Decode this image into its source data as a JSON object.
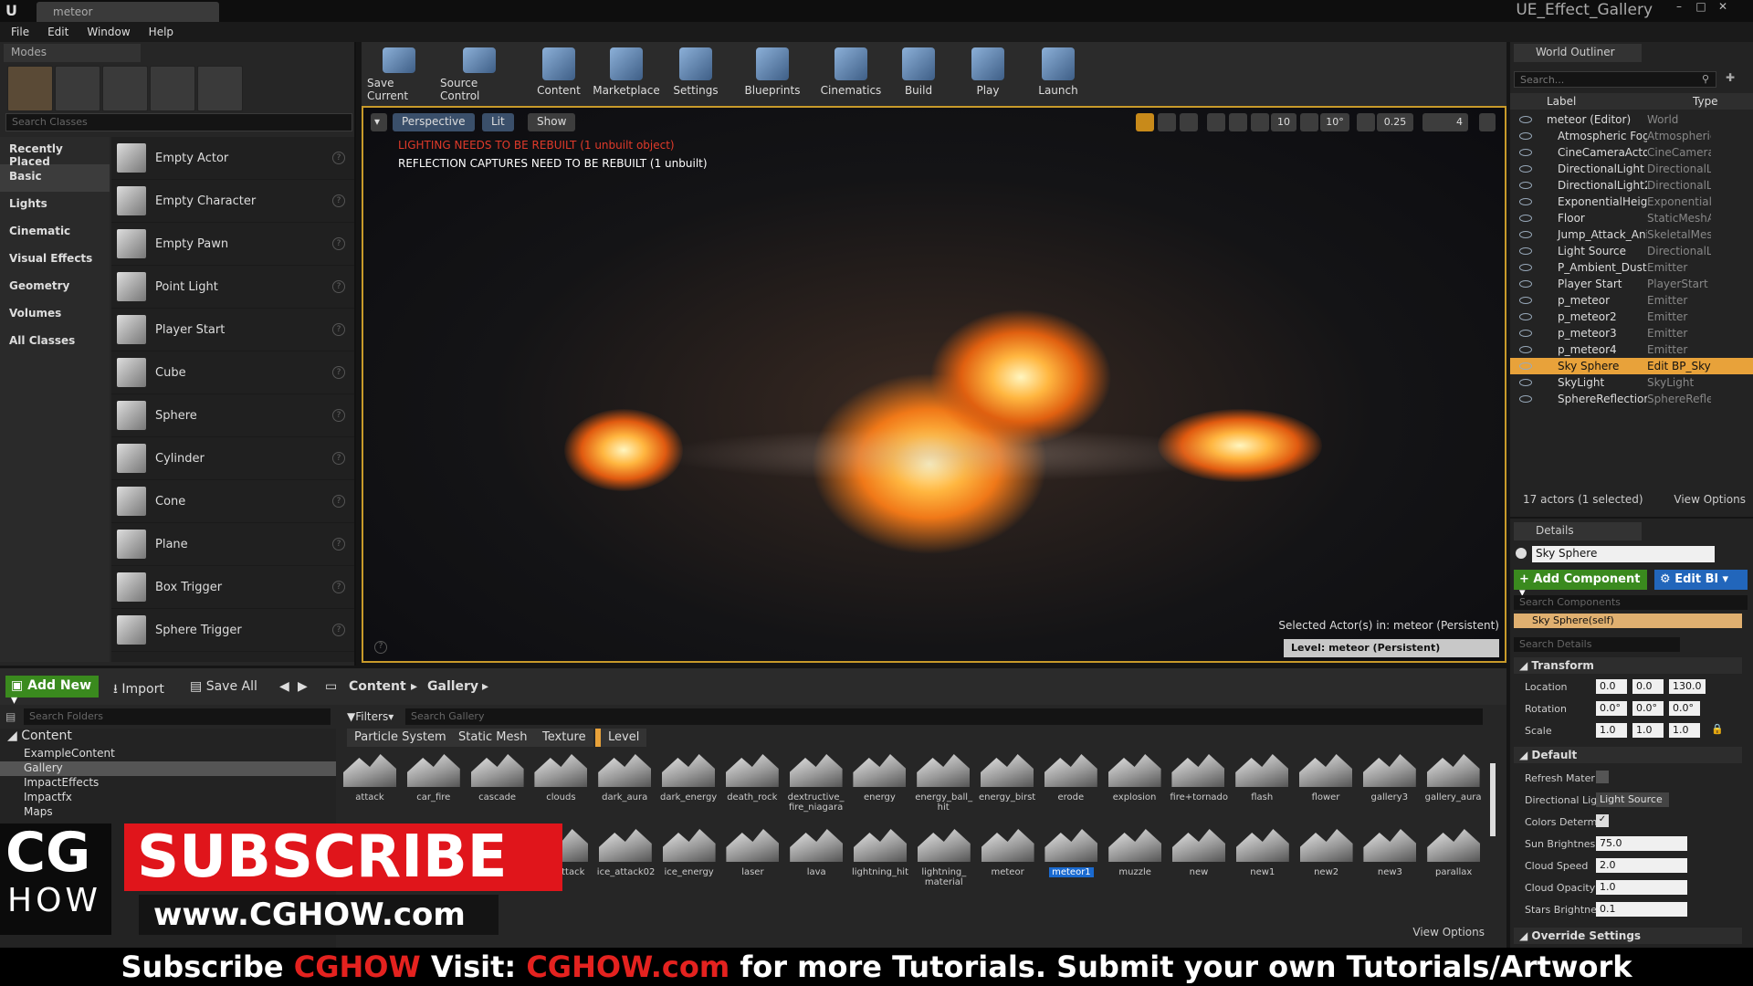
{
  "titlebar": {
    "doc_tab": "meteor",
    "app_title": "UE_Effect_Gallery"
  },
  "menu": [
    "File",
    "Edit",
    "Window",
    "Help"
  ],
  "modes": {
    "tab": "Modes",
    "search_placeholder": "Search Classes",
    "categories": [
      "Recently Placed",
      "Basic",
      "Lights",
      "Cinematic",
      "Visual Effects",
      "Geometry",
      "Volumes",
      "All Classes"
    ],
    "selected_category": "Basic",
    "classes": [
      "Empty Actor",
      "Empty Character",
      "Empty Pawn",
      "Point Light",
      "Player Start",
      "Cube",
      "Sphere",
      "Cylinder",
      "Cone",
      "Plane",
      "Box Trigger",
      "Sphere Trigger"
    ]
  },
  "toolbar": [
    "Save Current",
    "Source Control",
    "Content",
    "Marketplace",
    "Settings",
    "Blueprints",
    "Cinematics",
    "Build",
    "Play",
    "Launch"
  ],
  "viewport": {
    "perspective": "Perspective",
    "lit": "Lit",
    "show": "Show",
    "warning_lighting": "LIGHTING NEEDS TO BE REBUILT (1 unbuilt object)",
    "warning_reflection": "REFLECTION CAPTURES NEED TO BE REBUILT (1 unbuilt)",
    "grid_snap": "10",
    "rot_snap": "10°",
    "scale_snap": "0.25",
    "cam_speed": "4",
    "selected_info": "Selected Actor(s) in:  meteor (Persistent)",
    "level_info": "Level:  meteor (Persistent)",
    "colors": {
      "border": "#c89a2a",
      "fire_core": "#fff6c0",
      "fire_outer": "#f07818"
    }
  },
  "outliner": {
    "tab": "World Outliner",
    "search_placeholder": "Search...",
    "col_label": "Label",
    "col_type": "Type",
    "rows": [
      {
        "label": "meteor (Editor)",
        "type": "World"
      },
      {
        "label": "Atmospheric Fog",
        "type": "Atmospheric"
      },
      {
        "label": "CineCameraActor1",
        "type": "CineCamera"
      },
      {
        "label": "DirectionalLight",
        "type": "DirectionalLi"
      },
      {
        "label": "DirectionalLight2",
        "type": "DirectionalLi"
      },
      {
        "label": "ExponentialHeightFog",
        "type": "Exponentiall"
      },
      {
        "label": "Floor",
        "type": "StaticMeshA"
      },
      {
        "label": "Jump_Attack_Anim_m",
        "type": "SkeletalMesl"
      },
      {
        "label": "Light Source",
        "type": "DirectionalLi"
      },
      {
        "label": "P_Ambient_Dust1",
        "type": "Emitter"
      },
      {
        "label": "Player Start",
        "type": "PlayerStart"
      },
      {
        "label": "p_meteor",
        "type": "Emitter"
      },
      {
        "label": "p_meteor2",
        "type": "Emitter"
      },
      {
        "label": "p_meteor3",
        "type": "Emitter"
      },
      {
        "label": "p_meteor4",
        "type": "Emitter"
      },
      {
        "label": "Sky Sphere",
        "type": "Edit BP_Sky"
      },
      {
        "label": "SkyLight",
        "type": "SkyLight"
      },
      {
        "label": "SphereReflectionCapt",
        "type": "SphereRefle"
      }
    ],
    "selected": "Sky Sphere",
    "actor_count": "17 actors (1 selected)",
    "view_options": "View Options"
  },
  "details": {
    "tab": "Details",
    "actor_name": "Sky Sphere",
    "add_component": "Add Component",
    "edit_bp": "Edit Bl",
    "search_components": "Search Components",
    "self_component": "Sky Sphere(self)",
    "search_details": "Search Details",
    "transform": "Transform",
    "location_label": "Location",
    "location": [
      "0.0",
      "0.0",
      "130.0"
    ],
    "rotation_label": "Rotation",
    "rotation": [
      "0.0°",
      "0.0°",
      "0.0°"
    ],
    "scale_label": "Scale",
    "scale": [
      "1.0",
      "1.0",
      "1.0"
    ],
    "default": "Default",
    "refresh_label": "Refresh Mater",
    "dirlight_label": "Directional Lig",
    "dirlight_value": "Light Source",
    "colors_label": "Colors Determ",
    "sun_label": "Sun Brightnes",
    "sun_value": "75.0",
    "cloud_speed_label": "Cloud Speed",
    "cloud_speed_value": "2.0",
    "cloud_opacity_label": "Cloud Opacity",
    "cloud_opacity_value": "1.0",
    "stars_label": "Stars Brightne",
    "stars_value": "0.1",
    "override": "Override Settings"
  },
  "content_browser": {
    "add_new": "Add New",
    "import": "Import",
    "save_all": "Save All",
    "path": [
      "Content",
      "Gallery"
    ],
    "search_folders": "Search Folders",
    "folders": [
      {
        "name": "Content",
        "level": 0
      },
      {
        "name": "ExampleContent",
        "level": 1
      },
      {
        "name": "Gallery",
        "level": 1
      },
      {
        "name": "ImpactEffects",
        "level": 1
      },
      {
        "name": "Impactfx",
        "level": 1
      },
      {
        "name": "Maps",
        "level": 1
      }
    ],
    "selected_folder": "Gallery",
    "filters": "Filters",
    "search_placeholder": "Search Gallery",
    "filter_chips": [
      "Particle System",
      "Static Mesh",
      "Texture",
      "Level"
    ],
    "row1": [
      "attack",
      "car_fire",
      "cascade",
      "clouds",
      "dark_aura",
      "dark_energy",
      "death_rock",
      "dextructive_ fire_niagara",
      "energy",
      "energy_ball_ hit",
      "energy_birst",
      "erode",
      "explosion",
      "fire+tornado",
      "flash",
      "flower",
      "gallery3",
      "gallery_aura"
    ],
    "row2": [
      "ice_attack",
      "ice_attack02",
      "ice_energy",
      "laser",
      "lava",
      "lightning_hit",
      "lightning_ material",
      "meteor",
      "meteor1",
      "muzzle",
      "new",
      "new1",
      "new2",
      "new3",
      "parallax"
    ],
    "selected_asset": "meteor1",
    "view_options": "View Options"
  },
  "overlay": {
    "logo_top": "CG",
    "logo_bottom": "HOW",
    "subscribe": "SUBSCRIBE",
    "url": "www.CGHOW.com",
    "banner_parts": [
      "Subscribe ",
      "CGHOW",
      "  Visit: ",
      "CGHOW.com",
      " for more Tutorials.  Submit your own Tutorials/Artwork"
    ]
  }
}
